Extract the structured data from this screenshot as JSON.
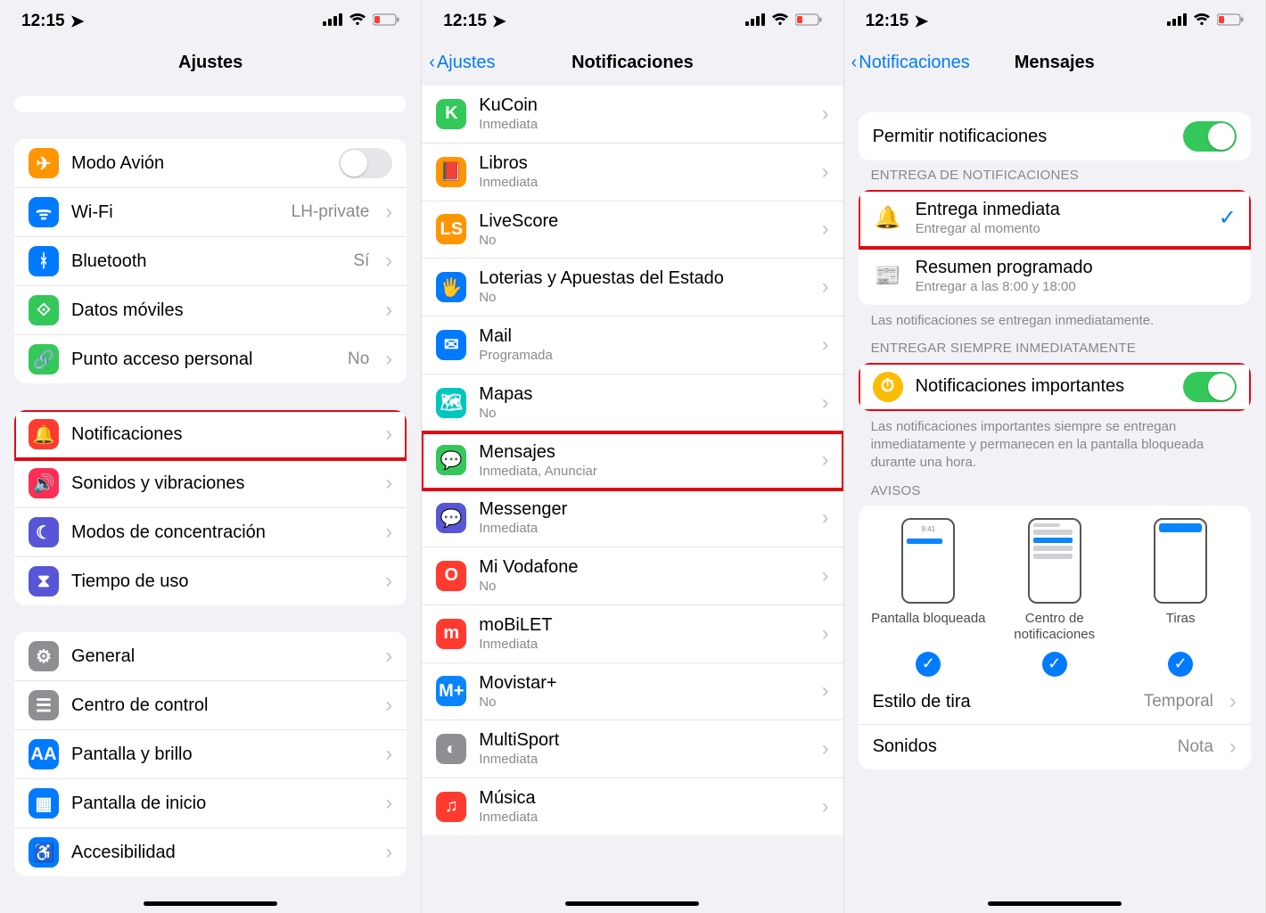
{
  "status": {
    "time": "12:15",
    "location_icon": "➤",
    "signal_icon": "••ıl",
    "wifi_icon": "wifi",
    "battery_icon": "battery-low"
  },
  "pane1": {
    "title": "Ajustes",
    "group1": [
      {
        "title": "Modo Avión",
        "icon": "airplane",
        "color": "bg-orange",
        "toggle": false
      },
      {
        "title": "Wi-Fi",
        "value": "LH-private",
        "icon": "wifi",
        "color": "bg-blue"
      },
      {
        "title": "Bluetooth",
        "value": "Sí",
        "icon": "bluetooth",
        "color": "bg-blue"
      },
      {
        "title": "Datos móviles",
        "icon": "antenna",
        "color": "bg-green"
      },
      {
        "title": "Punto acceso personal",
        "value": "No",
        "icon": "link",
        "color": "bg-green"
      }
    ],
    "group2": [
      {
        "title": "Notificaciones",
        "icon": "bell",
        "color": "bg-red",
        "highlight": true
      },
      {
        "title": "Sonidos y vibraciones",
        "icon": "speaker",
        "color": "bg-pink"
      },
      {
        "title": "Modos de concentración",
        "icon": "moon",
        "color": "bg-purple"
      },
      {
        "title": "Tiempo de uso",
        "icon": "hourglass",
        "color": "bg-purple"
      }
    ],
    "group3": [
      {
        "title": "General",
        "icon": "gear",
        "color": "bg-grey"
      },
      {
        "title": "Centro de control",
        "icon": "switches",
        "color": "bg-grey"
      },
      {
        "title": "Pantalla y brillo",
        "icon": "AA",
        "color": "bg-blue"
      },
      {
        "title": "Pantalla de inicio",
        "icon": "grid",
        "color": "bg-blue"
      },
      {
        "title": "Accesibilidad",
        "icon": "person",
        "color": "bg-blue"
      }
    ]
  },
  "pane2": {
    "back": "Ajustes",
    "title": "Notificaciones",
    "apps": [
      {
        "title": "KuCoin",
        "sub": "Inmediata",
        "icon": "K",
        "color": "bg-green"
      },
      {
        "title": "Libros",
        "sub": "Inmediata",
        "icon": "📕",
        "color": "bg-orange"
      },
      {
        "title": "LiveScore",
        "sub": "No",
        "icon": "LS",
        "color": "bg-orange"
      },
      {
        "title": "Loterias y Apuestas del Estado",
        "sub": "No",
        "icon": "🖐",
        "color": "bg-blue"
      },
      {
        "title": "Mail",
        "sub": "Programada",
        "icon": "✉",
        "color": "bg-blue"
      },
      {
        "title": "Mapas",
        "sub": "No",
        "icon": "🗺",
        "color": "bg-teal"
      },
      {
        "title": "Mensajes",
        "sub": "Inmediata, Anunciar",
        "icon": "💬",
        "color": "bg-green",
        "highlight": true
      },
      {
        "title": "Messenger",
        "sub": "Inmediata",
        "icon": "💬",
        "color": "bg-purple"
      },
      {
        "title": "Mi Vodafone",
        "sub": "No",
        "icon": "O",
        "color": "bg-red"
      },
      {
        "title": "moBiLET",
        "sub": "Inmediata",
        "icon": "m",
        "color": "bg-red"
      },
      {
        "title": "Movistar+",
        "sub": "No",
        "icon": "M+",
        "color": "bg-bluel"
      },
      {
        "title": "MultiSport",
        "sub": "Inmediata",
        "icon": "◐",
        "color": "bg-grey"
      },
      {
        "title": "Música",
        "sub": "Inmediata",
        "icon": "♫",
        "color": "bg-red"
      }
    ]
  },
  "pane3": {
    "back": "Notificaciones",
    "title": "Mensajes",
    "allow_label": "Permitir notificaciones",
    "allow_on": true,
    "delivery_header": "ENTREGA DE NOTIFICACIONES",
    "delivery": [
      {
        "title": "Entrega inmediata",
        "sub": "Entregar al momento",
        "icon": "🔔",
        "selected": true,
        "highlight": true
      },
      {
        "title": "Resumen programado",
        "sub": "Entregar a las 8:00 y 18:00",
        "icon": "📰",
        "selected": false
      }
    ],
    "delivery_note": "Las notificaciones se entregan inmediatamente.",
    "always_header": "ENTREGAR SIEMPRE INMEDIATAMENTE",
    "important_label": "Notificaciones importantes",
    "important_on": true,
    "important_highlight": true,
    "important_note": "Las notificaciones importantes siempre se entregan inmediatamente y permanecen en la pantalla bloqueada durante una hora.",
    "avisos_header": "AVISOS",
    "aviso_time": "9:41",
    "avisos": [
      {
        "label": "Pantalla bloqueada"
      },
      {
        "label": "Centro de notificaciones"
      },
      {
        "label": "Tiras"
      }
    ],
    "extra": [
      {
        "title": "Estilo de tira",
        "value": "Temporal"
      },
      {
        "title": "Sonidos",
        "value": "Nota"
      }
    ]
  }
}
